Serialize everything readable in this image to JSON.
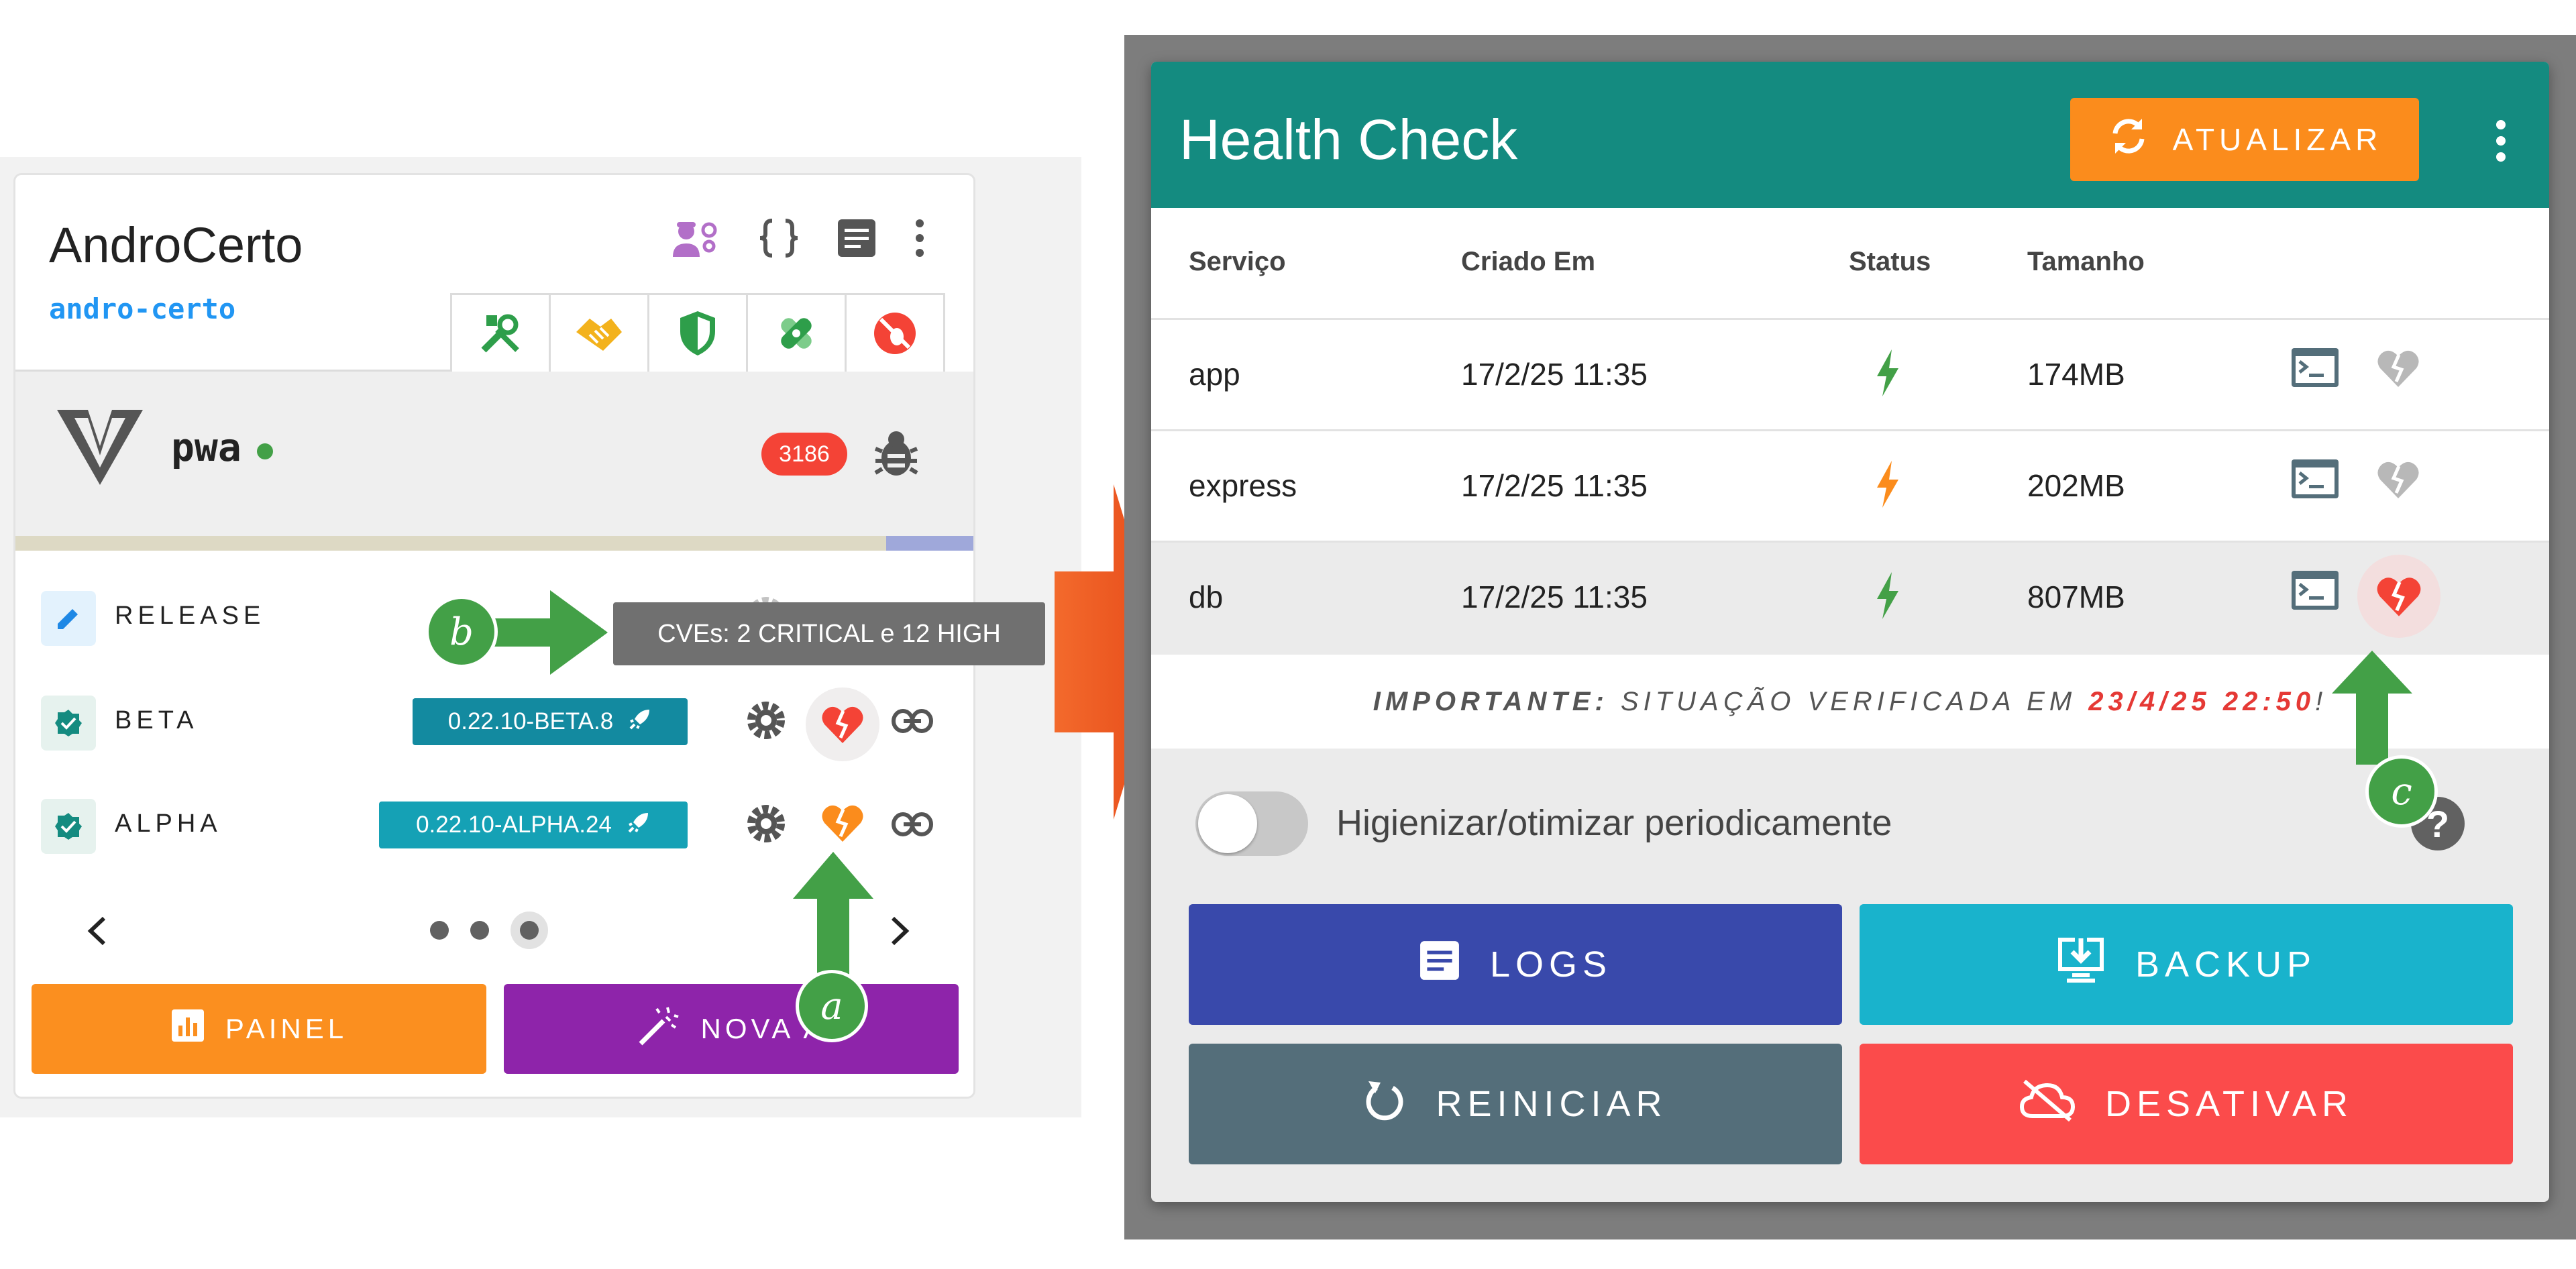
{
  "left": {
    "app_title": "AndroCerto",
    "app_slug": "andro-certo",
    "header_icons": [
      "engineer-icon",
      "braces-icon",
      "document-icon",
      "more-vert-icon"
    ],
    "tabs": [
      "tools-icon",
      "handshake-icon",
      "shield-icon",
      "bandage-icon",
      "cancel-bug-icon"
    ],
    "environment": {
      "name": "pwa",
      "status_color": "#43a047",
      "count": "3186",
      "progress_fraction": 0.905
    },
    "channels": [
      {
        "label": "RELEASE",
        "version": ""
      },
      {
        "label": "BETA",
        "version": "0.22.10-BETA.8"
      },
      {
        "label": "ALPHA",
        "version": "0.22.10-ALPHA.24"
      }
    ],
    "pagination": {
      "pages": 3,
      "active": 3
    },
    "buttons": {
      "panel": "PAINEL",
      "new": "NOVA A"
    }
  },
  "tooltip": "CVEs: 2 CRITICAL e 12 HIGH",
  "callouts": {
    "a": "a",
    "b": "b",
    "c": "c"
  },
  "health_check": {
    "title": "Health Check",
    "refresh_label": "ATUALIZAR",
    "columns": {
      "service": "Serviço",
      "created": "Criado Em",
      "status": "Status",
      "size": "Tamanho"
    },
    "rows": [
      {
        "service": "app",
        "created": "17/2/25 11:35",
        "status_color": "#43a047",
        "size": "174MB",
        "health": "ok"
      },
      {
        "service": "express",
        "created": "17/2/25 11:35",
        "status_color": "#fb8c1c",
        "size": "202MB",
        "health": "ok"
      },
      {
        "service": "db",
        "created": "17/2/25 11:35",
        "status_color": "#43a047",
        "size": "807MB",
        "health": "alert"
      }
    ],
    "notice": {
      "prefix": "IMPORTANTE:",
      "text": " SITUAÇÃO VERIFICADA EM ",
      "date": "23/4/25 22:50",
      "suffix": "!"
    },
    "toggle_label": "Higienizar/otimizar periodicamente",
    "help_label": "?",
    "actions": {
      "logs": "LOGS",
      "backup": "BACKUP",
      "restart": "REINICIAR",
      "disable": "DESATIVAR"
    }
  },
  "colors": {
    "teal": "#148b80",
    "orange": "#fb8c1c",
    "purple": "#8e24aa",
    "indigo": "#3949ab",
    "cyan": "#19b3cc",
    "slate": "#546e7a",
    "red": "#fb4b4b"
  }
}
